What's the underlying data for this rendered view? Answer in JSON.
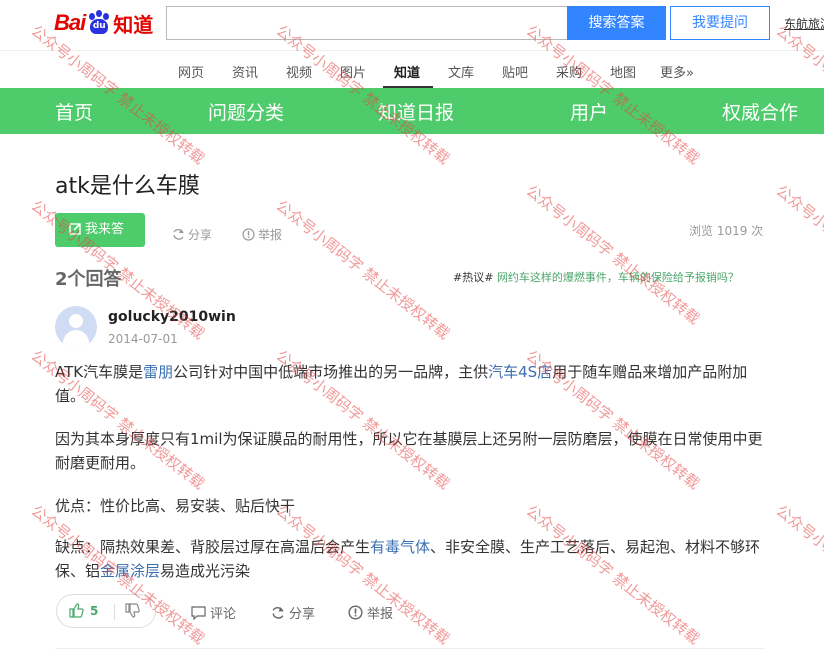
{
  "header": {
    "logo_text_left": "Bai",
    "logo_paw_text": "du",
    "logo_text_right": "知道",
    "search_value": "",
    "search_button": "搜索答案",
    "ask_button": "我要提问",
    "right_link": "东航旅游"
  },
  "subnav": {
    "items": [
      "网页",
      "资讯",
      "视频",
      "图片",
      "知道",
      "文库",
      "贴吧",
      "采购",
      "地图",
      "更多»"
    ]
  },
  "mainnav": {
    "items": [
      "首页",
      "问题分类",
      "知道日报",
      "用户",
      "权威合作"
    ]
  },
  "question": {
    "title": "atk是什么车膜",
    "answer_button": "我来答",
    "share": "分享",
    "report": "举报",
    "views": "浏览 1019 次"
  },
  "answers": {
    "count_label": "2个回答",
    "hot_tag": "#热议#",
    "hot_link": "网约车这样的爆燃事件，车辆的保险给予报销吗？"
  },
  "answer": {
    "username": "golucky2010win",
    "date": "2014-07-01",
    "p1_a": "ATK汽车膜是",
    "p1_link1": "雷朋",
    "p1_b": "公司针对中国中低端市场推出的另一品牌，主供",
    "p1_link2": "汽车4S店",
    "p1_c": "用于随车赠品来增加产品附加值。",
    "p2": "因为其本身厚度只有1mil为保证膜品的耐用性，所以它在基膜层上还另附一层防磨层，使膜在日常使用中更耐磨更耐用。",
    "p3": "优点：性价比高、易安装、贴后快干",
    "p4_a": "缺点：隔热效果差、背胶层过厚在高温后会产生",
    "p4_link1": "有毒气体",
    "p4_b": "、非安全膜、生产工艺落后、易起泡、材料不够环保、铝",
    "p4_link2": "金属涂层",
    "p4_c": "易造成光污染",
    "likes": "5",
    "comment": "评论",
    "share": "分享",
    "report": "举报"
  },
  "watermark": {
    "text": "公众号小周码字 禁止未授权转载"
  },
  "colors": {
    "brand_green": "#4ecb6a",
    "search_blue": "#3385ff",
    "link_blue": "#3a6fb0",
    "baidu_red": "#e10602"
  }
}
